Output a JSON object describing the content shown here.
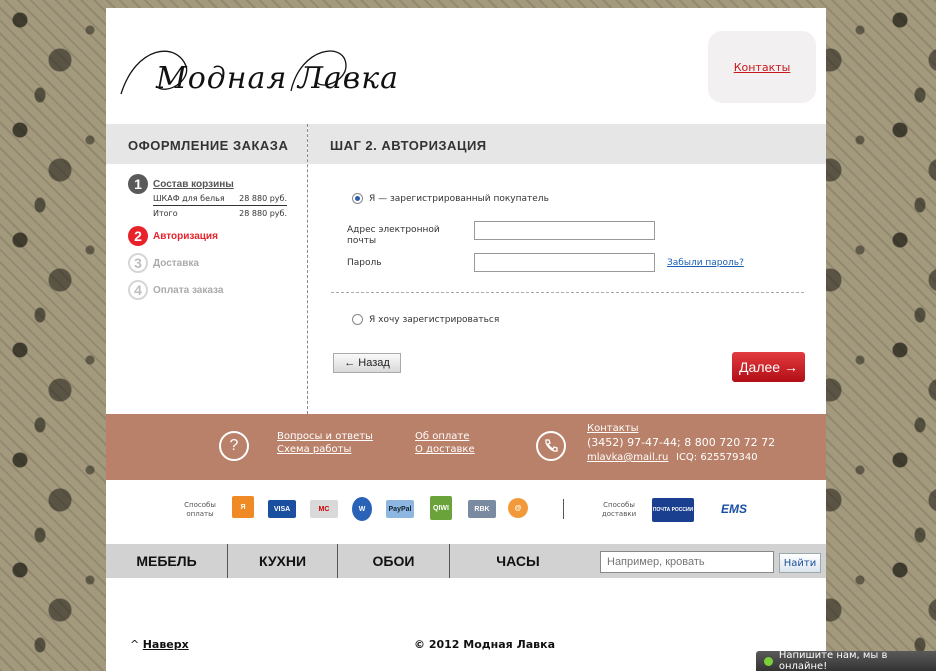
{
  "header": {
    "logo_text": "Модная Лавка",
    "contacts_link": "Контакты"
  },
  "sidebar": {
    "title": "ОФОРМЛЕНИЕ ЗАКАЗА",
    "steps": [
      {
        "num": "1",
        "label": "Состав корзины",
        "state": "done"
      },
      {
        "num": "2",
        "label": "Авторизация",
        "state": "active"
      },
      {
        "num": "3",
        "label": "Доставка",
        "state": "todo"
      },
      {
        "num": "4",
        "label": "Оплата заказа",
        "state": "todo"
      }
    ],
    "cart": [
      {
        "name": "ШКАФ для белья",
        "price": "28 880 руб."
      },
      {
        "name": "Итого",
        "price": "28 880 руб."
      }
    ]
  },
  "main": {
    "title": "ШАГ 2. АВТОРИЗАЦИЯ",
    "option_registered": "Я — зарегистрированный покупатель",
    "email_label": "Адрес электронной почты",
    "password_label": "Пароль",
    "email_value": "",
    "password_value": "",
    "forgot_password": "Забыли пароль?",
    "option_register": "Я хочу зарегистрироваться",
    "back_button": "← Назад",
    "next_button": "Далее →"
  },
  "info_band": {
    "faq_link": "Вопросы и ответы",
    "scheme_link": "Схема работы",
    "payment_link": "Об оплате",
    "delivery_link": "О доставке",
    "contacts_link": "Контакты",
    "phone": "(3452) 97-47-44; 8 800 720 72 72",
    "email": "mlavka@mail.ru",
    "icq": "ICQ: 625579340"
  },
  "payment_strip": {
    "payment_label": "Способы оплаты",
    "delivery_label": "Способы доставки",
    "payment_icons": [
      "Я",
      "VISA",
      "MC",
      "W",
      "PayPal",
      "QIWI",
      "RBK",
      "@"
    ],
    "delivery_icons": [
      "ПОЧТА РОССИИ",
      "EMS"
    ]
  },
  "nav": {
    "items": [
      "МЕБЕЛЬ",
      "КУХНИ",
      "ОБОИ",
      "ЧАСЫ"
    ],
    "search_placeholder": "Например, кровать",
    "search_button": "Найти"
  },
  "footer": {
    "up_arrow": "^",
    "up_link": "Наверх",
    "copyright": "©  2012 Модная Лавка"
  },
  "chat": {
    "label": "Напишите нам, мы в онлайне!"
  }
}
